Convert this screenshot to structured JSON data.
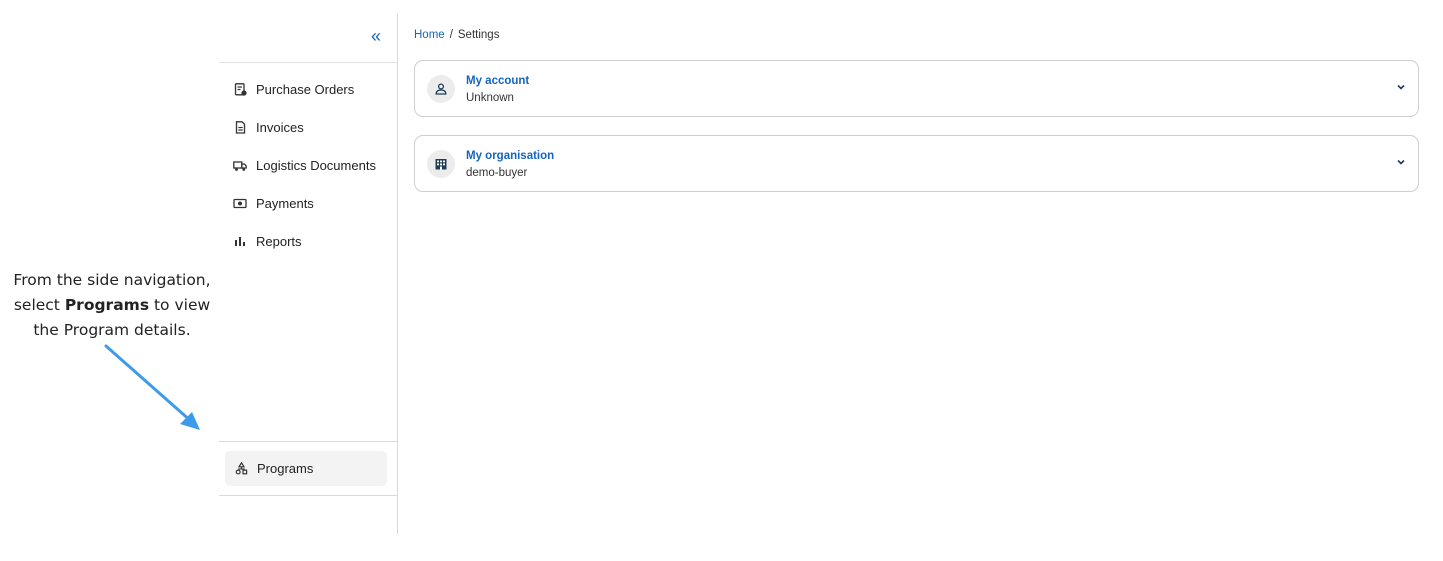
{
  "annotation": {
    "line1": "From the side navigation,",
    "line2_pre": "select ",
    "line2_bold": "Programs",
    "line2_post": " to view",
    "line3": "the Program details."
  },
  "sidebar": {
    "collapse_glyph": "«",
    "items": [
      {
        "label": "Purchase Orders",
        "icon": "purchase-orders-icon"
      },
      {
        "label": "Invoices",
        "icon": "invoice-icon"
      },
      {
        "label": "Logistics Documents",
        "icon": "truck-icon"
      },
      {
        "label": "Payments",
        "icon": "payments-icon"
      },
      {
        "label": "Reports",
        "icon": "bar-chart-icon"
      }
    ],
    "bottom_item": {
      "label": "Programs",
      "icon": "programs-icon"
    }
  },
  "breadcrumb": {
    "home": "Home",
    "separator": "/",
    "current": "Settings"
  },
  "cards": [
    {
      "title": "My account",
      "subtitle": "Unknown",
      "icon": "user-icon"
    },
    {
      "title": "My organisation",
      "subtitle": "demo-buyer",
      "icon": "building-icon"
    }
  ],
  "colors": {
    "accent": "#1565c0",
    "arrow": "#3d9be9"
  }
}
